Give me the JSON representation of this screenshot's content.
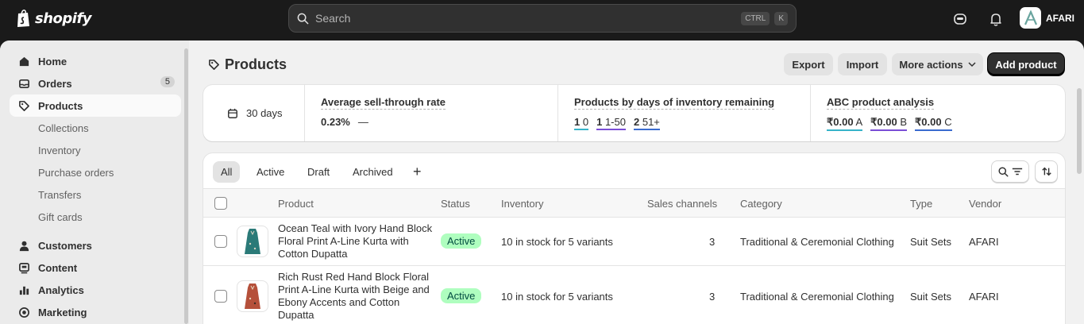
{
  "topbar": {
    "logo": "shopify",
    "search_placeholder": "Search",
    "shortcut_keys": [
      "CTRL",
      "K"
    ],
    "store_name": "AFARI",
    "store_initial": "A"
  },
  "sidebar": {
    "items": [
      {
        "label": "Home",
        "icon": "home-icon"
      },
      {
        "label": "Orders",
        "icon": "inbox-icon",
        "badge": "5"
      },
      {
        "label": "Products",
        "icon": "tag-icon",
        "active": true
      },
      {
        "label": "Customers",
        "icon": "person-icon"
      },
      {
        "label": "Content",
        "icon": "content-icon"
      },
      {
        "label": "Analytics",
        "icon": "bar-chart-icon"
      },
      {
        "label": "Marketing",
        "icon": "target-icon"
      }
    ],
    "sub_items": [
      "Collections",
      "Inventory",
      "Purchase orders",
      "Transfers",
      "Gift cards"
    ]
  },
  "page": {
    "title": "Products",
    "actions": {
      "export": "Export",
      "import": "Import",
      "more": "More actions",
      "add": "Add product"
    }
  },
  "metrics": {
    "period": "30 days",
    "sell_through": {
      "title": "Average sell-through rate",
      "value": "0.23%",
      "trend": "—"
    },
    "days_inventory": {
      "title": "Products by days of inventory remaining",
      "segments": [
        {
          "count": "1",
          "label": "0"
        },
        {
          "count": "1",
          "label": "1-50"
        },
        {
          "count": "2",
          "label": "51+"
        }
      ]
    },
    "abc": {
      "title": "ABC product analysis",
      "segments": [
        {
          "value": "₹0.00",
          "grade": "A"
        },
        {
          "value": "₹0.00",
          "grade": "B"
        },
        {
          "value": "₹0.00",
          "grade": "C"
        }
      ]
    }
  },
  "tabs": [
    "All",
    "Active",
    "Draft",
    "Archived",
    "+"
  ],
  "table": {
    "headers": [
      "Product",
      "Status",
      "Inventory",
      "Sales channels",
      "Category",
      "Type",
      "Vendor"
    ],
    "rows": [
      {
        "name": "Ocean Teal with Ivory Hand Block Floral Print A-Line Kurta with Cotton Dupatta",
        "status": "Active",
        "inventory": "10 in stock for 5 variants",
        "channels": "3",
        "category": "Traditional & Ceremonial Clothing",
        "type": "Suit Sets",
        "vendor": "AFARI",
        "thumb_color": "#2b7a78"
      },
      {
        "name": "Rich Rust Red Hand Block Floral Print A-Line Kurta with Beige and Ebony Accents and Cotton Dupatta",
        "status": "Active",
        "inventory": "10 in stock for 5 variants",
        "channels": "3",
        "category": "Traditional & Ceremonial Clothing",
        "type": "Suit Sets",
        "vendor": "AFARI",
        "thumb_color": "#b5503a"
      }
    ]
  }
}
